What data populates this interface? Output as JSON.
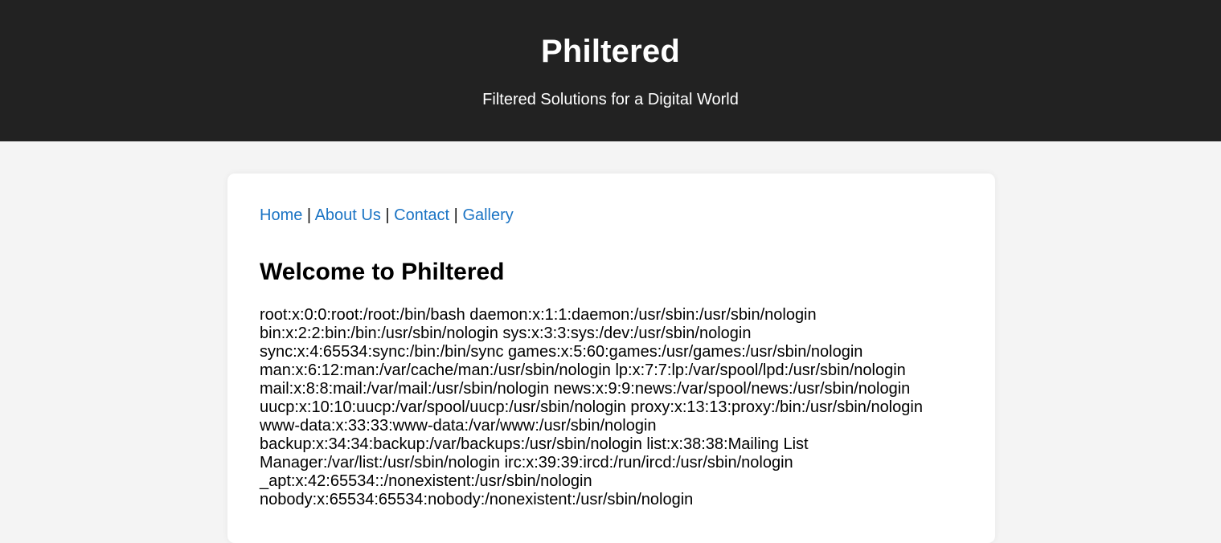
{
  "header": {
    "title": "Philtered",
    "tagline": "Filtered Solutions for a Digital World"
  },
  "nav": {
    "items": [
      {
        "label": "Home"
      },
      {
        "label": "About Us"
      },
      {
        "label": "Contact"
      },
      {
        "label": "Gallery"
      }
    ],
    "separator": "|"
  },
  "main": {
    "heading": "Welcome to Philtered",
    "body_text": "root:x:0:0:root:/root:/bin/bash daemon:x:1:1:daemon:/usr/sbin:/usr/sbin/nologin bin:x:2:2:bin:/bin:/usr/sbin/nologin sys:x:3:3:sys:/dev:/usr/sbin/nologin sync:x:4:65534:sync:/bin:/bin/sync games:x:5:60:games:/usr/games:/usr/sbin/nologin man:x:6:12:man:/var/cache/man:/usr/sbin/nologin lp:x:7:7:lp:/var/spool/lpd:/usr/sbin/nologin mail:x:8:8:mail:/var/mail:/usr/sbin/nologin news:x:9:9:news:/var/spool/news:/usr/sbin/nologin uucp:x:10:10:uucp:/var/spool/uucp:/usr/sbin/nologin proxy:x:13:13:proxy:/bin:/usr/sbin/nologin www-data:x:33:33:www-data:/var/www:/usr/sbin/nologin backup:x:34:34:backup:/var/backups:/usr/sbin/nologin list:x:38:38:Mailing List Manager:/var/list:/usr/sbin/nologin irc:x:39:39:ircd:/run/ircd:/usr/sbin/nologin _apt:x:42:65534::/nonexistent:/usr/sbin/nologin nobody:x:65534:65534:nobody:/nonexistent:/usr/sbin/nologin"
  },
  "colors": {
    "header_bg": "#222222",
    "page_bg": "#f4f4f4",
    "card_bg": "#ffffff",
    "link": "#1b74c4"
  }
}
